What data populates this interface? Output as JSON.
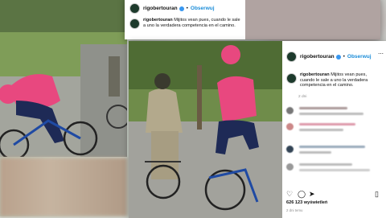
{
  "post": {
    "username": "rigobertouran",
    "follow_label": "Obserwuj",
    "separator": "•",
    "caption": "Mijitos vean pues, cuando le sale a uno la verdadera competencia en el camino.",
    "time_ago": "2 dni",
    "likes": "626 123 wyświetleń",
    "date": "2 dni temu"
  },
  "icons": {
    "like": "heart-icon",
    "comment": "comment-icon",
    "share": "send-icon",
    "save": "bookmark-icon"
  },
  "colors": {
    "follow": "#1a8cd8",
    "verified": "#3897f0",
    "jersey": "#e8487f"
  }
}
